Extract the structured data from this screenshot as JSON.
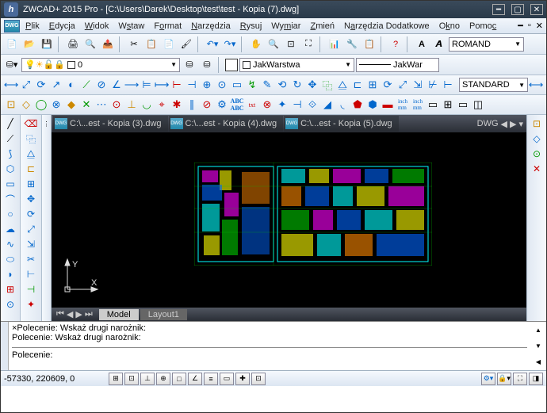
{
  "title": "ZWCAD+ 2015 Pro - [C:\\Users\\Darek\\Desktop\\test\\test - Kopia (7).dwg]",
  "menu": {
    "items": [
      "Plik",
      "Edycja",
      "Widok",
      "Wstaw",
      "Format",
      "Narzędzia",
      "Rysuj",
      "Wymiar",
      "Zmień",
      "Narzędzia Dodatkowe",
      "Okno",
      "Pomoc"
    ]
  },
  "toolbar1": {
    "font": "ROMAND"
  },
  "toolbar2": {
    "layer": "0",
    "lineweight": "JakWarstwa",
    "linetype": "JakWar"
  },
  "toolbar3": {
    "style": "STANDARD"
  },
  "tabs": [
    {
      "label": "C:\\...est - Kopia (3).dwg",
      "active": false
    },
    {
      "label": "C:\\...est - Kopia (4).dwg",
      "active": false
    },
    {
      "label": "C:\\...est - Kopia (5).dwg",
      "active": false
    }
  ],
  "layout_tabs": [
    "Model",
    "Layout1"
  ],
  "cmd": {
    "line1": "×Polecenie: Wskaż drugi narożnik:",
    "line2": " Polecenie: Wskaż drugi narożnik:",
    "prompt": " Polecenie:"
  },
  "status": {
    "coords": "-57330, 220609, 0"
  },
  "ucs": {
    "x": "X",
    "y": "Y"
  }
}
